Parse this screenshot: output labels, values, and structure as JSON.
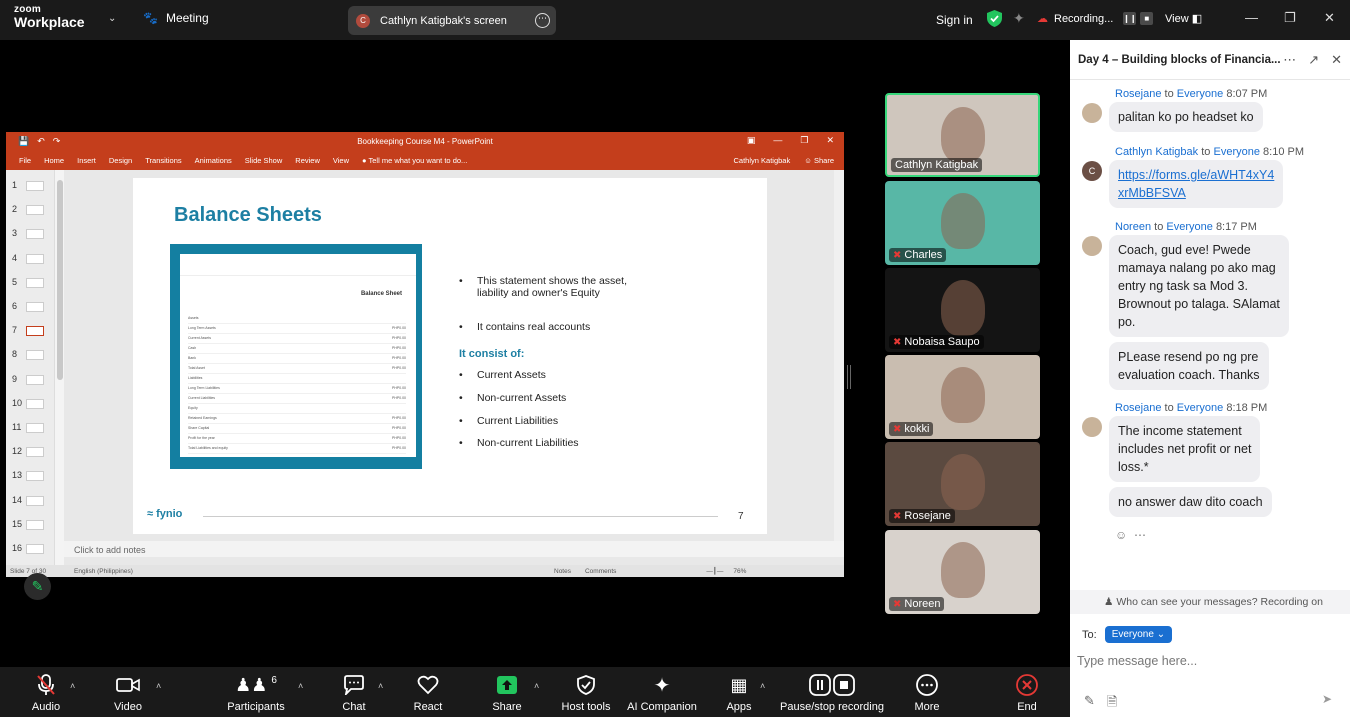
{
  "topbar": {
    "logo_line1": "zoom",
    "logo_line2": "Workplace",
    "meeting_label": "Meeting",
    "screen_share_label": "Cathlyn Katigbak's screen",
    "screen_share_initial": "C",
    "signin": "Sign in",
    "recording_label": "Recording...",
    "view_label": "View"
  },
  "ppt": {
    "window_title": "Bookkeeping Course M4 - PowerPoint",
    "menu": [
      "File",
      "Home",
      "Insert",
      "Design",
      "Transitions",
      "Animations",
      "Slide Show",
      "Review",
      "View",
      "Tell me what you want to do..."
    ],
    "user": "Cathlyn Katigbak",
    "share": "Share",
    "thumb_numbers": [
      "1",
      "2",
      "3",
      "4",
      "5",
      "6",
      "7",
      "8",
      "9",
      "10",
      "11",
      "12",
      "13",
      "14",
      "15",
      "16"
    ],
    "selected_thumb": 7,
    "notes_placeholder": "Click to add notes",
    "status_slide": "Slide 7 of 30",
    "status_lang": "English (Philippines)",
    "status_notes": "Notes",
    "status_comments": "Comments",
    "zoom_level": "76%"
  },
  "slide": {
    "title": "Balance Sheets",
    "bullets_top": [
      "This statement shows the asset,",
      "liability and owner's Equity",
      "It contains real accounts"
    ],
    "consist_heading": "It consist of:",
    "bullets": [
      "Current Assets",
      "Non-current Assets",
      "Current Liabilities",
      "Non-current Liabilities"
    ],
    "brand": "fynio",
    "page_number": "7",
    "bs_title": "Balance Sheet",
    "bs_rows": [
      [
        "Assets",
        ""
      ],
      [
        "Long Term Assets",
        "PHP0.00"
      ],
      [
        "Current Assets",
        "PHP0.00"
      ],
      [
        "Cash",
        "PHP0.00"
      ],
      [
        "Bank",
        "PHP0.00"
      ],
      [
        "Total Asset",
        "PHP0.00"
      ],
      [
        "Liabilities",
        ""
      ],
      [
        "Long Term Liabilities",
        "PHP0.00"
      ],
      [
        "Current Liabilities",
        "PHP0.00"
      ],
      [
        "Equity",
        ""
      ],
      [
        "Retained Earnings",
        "PHP0.00"
      ],
      [
        "Share Capital",
        "PHP0.00"
      ],
      [
        "Profit for the year",
        "PHP0.00"
      ],
      [
        "Total Liabilities and equity",
        "PHP0.00"
      ]
    ]
  },
  "participants_tiles": [
    {
      "name": "Cathlyn Katigbak",
      "muted": false,
      "active": true,
      "bg": "#cfc6bd"
    },
    {
      "name": "Charles",
      "muted": true,
      "active": false,
      "bg": "#58b7a6"
    },
    {
      "name": "Nobaisa Saupo",
      "muted": true,
      "active": false,
      "bg": "#141414"
    },
    {
      "name": "kokki",
      "muted": true,
      "active": false,
      "bg": "#c9bdb0"
    },
    {
      "name": "Rosejane",
      "muted": true,
      "active": false,
      "bg": "#5b4a40"
    },
    {
      "name": "Noreen",
      "muted": true,
      "active": false,
      "bg": "#d8d2cc"
    }
  ],
  "chat": {
    "title": "Day 4 – Building blocks of Financia...",
    "to_word": "to",
    "messages": [
      {
        "sender": "Rosejane",
        "to": "Everyone",
        "time": "8:07 PM",
        "text": [
          "palitan ko po headset ko"
        ]
      },
      {
        "sender": "Cathlyn Katigbak",
        "to": "Everyone",
        "time": "8:10 PM",
        "link": [
          "https://forms.gle/aWHT4xY4",
          "xrMbBFSVA"
        ]
      },
      {
        "sender": "Noreen",
        "to": "Everyone",
        "time": "8:17 PM",
        "text": [
          "Coach, gud eve! Pwede",
          "mamaya nalang po ako mag",
          "entry ng task sa Mod 3.",
          "Brownout po talaga. SAlamat",
          "po."
        ]
      },
      {
        "text": [
          "PLease resend po ng pre",
          "evaluation coach. Thanks"
        ]
      },
      {
        "sender": "Rosejane",
        "to": "Everyone",
        "time": "8:18 PM",
        "text": [
          "The income statement",
          "includes net profit or net",
          "loss.*"
        ]
      },
      {
        "text": [
          "no answer daw dito coach"
        ]
      }
    ],
    "privacy_note": "Who can see your messages? Recording on",
    "to_label": "To:",
    "recipient": "Everyone",
    "input_placeholder": "Type message here..."
  },
  "toolbar": {
    "audio": "Audio",
    "video": "Video",
    "participants": "Participants",
    "participants_count": "6",
    "chat": "Chat",
    "react": "React",
    "share": "Share",
    "host_tools": "Host tools",
    "ai_companion": "AI Companion",
    "apps": "Apps",
    "pause_recording": "Pause/stop recording",
    "more": "More",
    "end": "End"
  }
}
